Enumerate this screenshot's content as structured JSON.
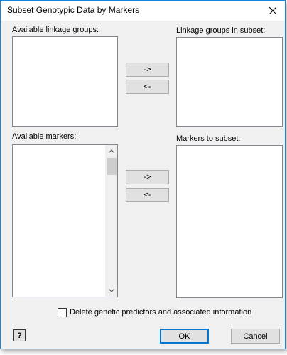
{
  "window": {
    "title": "Subset Genotypic Data by Markers",
    "close_glyph": "close-icon",
    "accent_color": "#1883d7"
  },
  "linkage": {
    "available_label": "Available linkage groups:",
    "subset_label": "Linkage groups in subset:",
    "add_button": "->",
    "remove_button": "<-",
    "available_items": [],
    "subset_items": []
  },
  "markers": {
    "available_label": "Available markers:",
    "subset_label": "Markers to subset:",
    "add_button": "->",
    "remove_button": "<-",
    "available_items": [],
    "subset_items": []
  },
  "options": {
    "delete_label": "Delete genetic predictors and associated information",
    "delete_checked": false
  },
  "footer": {
    "help_glyph": "?",
    "ok_label": "OK",
    "cancel_label": "Cancel"
  }
}
